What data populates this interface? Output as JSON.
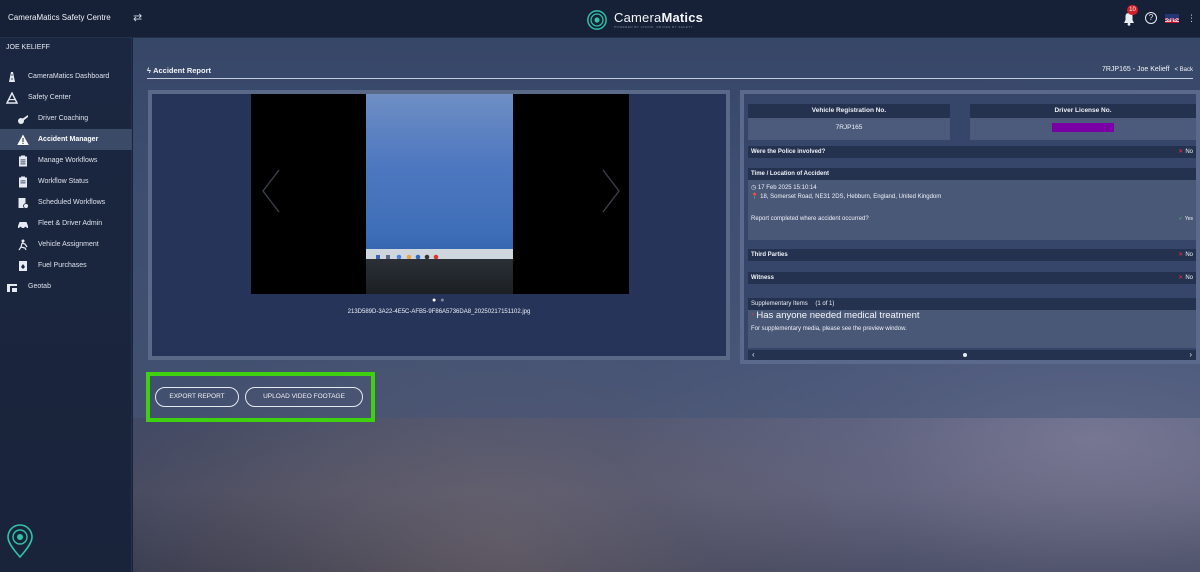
{
  "app": {
    "title": "CameraMatics Safety Centre",
    "brand_prefix": "Camera",
    "brand_bold": "Matics",
    "brand_tagline": "POWERED BY VISION. DRIVEN BY SAFETY",
    "notification_count": "10"
  },
  "user": {
    "name": "JOE KELIEFF"
  },
  "sidebar": {
    "items": [
      {
        "label": "CameraMatics Dashboard",
        "icon": "road-icon",
        "level": "top"
      },
      {
        "label": "Safety Center",
        "icon": "warning-cone-icon",
        "level": "top"
      },
      {
        "label": "Driver Coaching",
        "icon": "whistle-icon",
        "level": "sub"
      },
      {
        "label": "Accident Manager",
        "icon": "alert-triangle-icon",
        "level": "sub",
        "active": true
      },
      {
        "label": "Manage Workflows",
        "icon": "clipboard-icon",
        "level": "sub"
      },
      {
        "label": "Workflow Status",
        "icon": "clipboard-list-icon",
        "level": "sub"
      },
      {
        "label": "Scheduled Workflows",
        "icon": "calendar-doc-icon",
        "level": "sub"
      },
      {
        "label": "Fleet & Driver Admin",
        "icon": "car-icon",
        "level": "sub"
      },
      {
        "label": "Vehicle Assignment",
        "icon": "person-run-icon",
        "level": "sub"
      },
      {
        "label": "Fuel Purchases",
        "icon": "fuel-doc-icon",
        "level": "sub"
      },
      {
        "label": "Geotab",
        "icon": "geotab-icon",
        "level": "top"
      }
    ]
  },
  "header": {
    "title": "Accident Report",
    "vehicle_driver": "7RJP165 - Joe Kelieff",
    "back_label": "< Back"
  },
  "media": {
    "filename": "213D589D-3A22-4E5C-AFB5-9F86A5736DA8_20250217151102.jpg",
    "slide_count": 2,
    "active_slide": 1
  },
  "details": {
    "vehicle_reg_label": "Vehicle Registration No.",
    "vehicle_reg_value": "7RJP165",
    "driver_license_label": "Driver License No.",
    "police_label": "Were the Police involved?",
    "police_value": "No",
    "time_location_label": "Time / Location of Accident",
    "datetime": "17 Feb 2025 15:10:14",
    "location": "18, Somerset Road, NE31 2DS, Hebburn, England, United Kingdom",
    "report_completed_label": "Report completed where accident occurred?",
    "report_completed_value": "Yes",
    "third_parties_label": "Third Parties",
    "third_parties_value": "No",
    "witness_label": "Witness",
    "witness_value": "No",
    "supplementary_label": "Supplementary Items",
    "supplementary_count": "(1 of 1)",
    "supplementary_question": "Has anyone needed medical treatment",
    "supplementary_note": "For supplementary media, please see the preview window."
  },
  "actions": {
    "export_label": "EXPORT REPORT",
    "upload_label": "UPLOAD VIDEO FOOTAGE"
  },
  "colors": {
    "highlight": "#3fd10f",
    "no_mark": "#e8343d",
    "yes_mark": "#4bd36a",
    "redaction": "#7a00a6",
    "badge": "#d0202a"
  }
}
